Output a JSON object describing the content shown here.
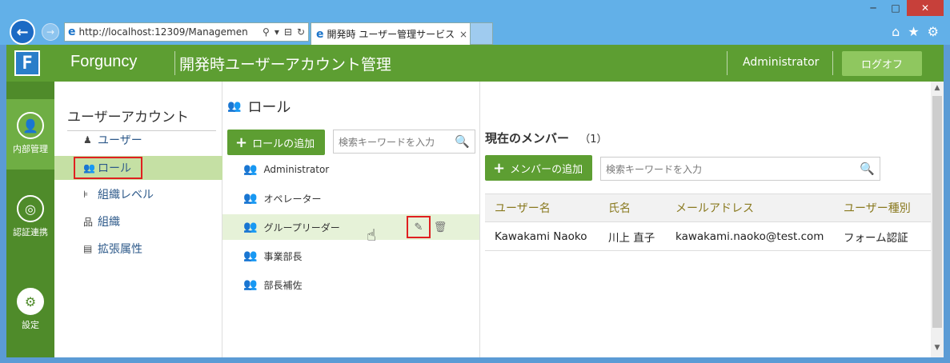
{
  "browser": {
    "url": "http://localhost:12309/Managemen",
    "tab_title": "開発時 ユーザー管理サービス",
    "tab_close": "×",
    "back": "←",
    "forward": "→",
    "minimize": "─",
    "maximize": "□",
    "close": "✕"
  },
  "header": {
    "brand": "Forguncy",
    "title": "開発時ユーザーアカウント管理",
    "user": "Administrator",
    "logout": "ログオフ",
    "logo_letter": "F"
  },
  "rail": {
    "items": [
      {
        "label": "内部管理"
      },
      {
        "label": "認証連携"
      },
      {
        "label": "設定"
      }
    ]
  },
  "sidemenu": {
    "title": "ユーザーアカウント",
    "items": [
      {
        "label": "ユーザー"
      },
      {
        "label": "ロール"
      },
      {
        "label": "組織レベル"
      },
      {
        "label": "組織"
      },
      {
        "label": "拡張属性"
      }
    ]
  },
  "roles": {
    "title": "ロール",
    "add_button": "ロールの追加",
    "search_placeholder": "検索キーワードを入力",
    "items": [
      {
        "label": "Administrator"
      },
      {
        "label": "オペレーター"
      },
      {
        "label": "グループリーダー"
      },
      {
        "label": "事業部長"
      },
      {
        "label": "部長補佐"
      }
    ]
  },
  "members": {
    "title": "現在のメンバー",
    "count": "（1）",
    "add_button": "メンバーの追加",
    "search_placeholder": "検索キーワードを入力",
    "columns": [
      "ユーザー名",
      "氏名",
      "メールアドレス",
      "ユーザー種別"
    ],
    "rows": [
      [
        "Kawakami Naoko",
        "川上 直子",
        "kawakami.naoko@test.com",
        "フォーム認証"
      ]
    ]
  }
}
